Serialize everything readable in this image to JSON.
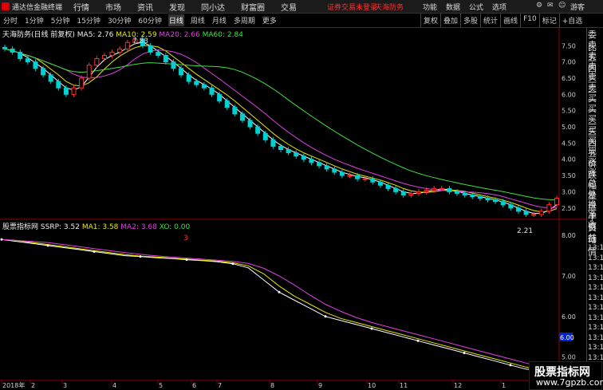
{
  "app": {
    "title": "通达信金融终端"
  },
  "menu": [
    "行情",
    "市场",
    "资讯",
    "发现",
    "同小达",
    "财富圈",
    "交易"
  ],
  "warning": "证券交易未登录",
  "stock_link": "天海防务",
  "right_menu": [
    "功能",
    "数据",
    "公式",
    "选项"
  ],
  "guest_label": "游客",
  "periods": [
    "分时",
    "1分钟",
    "5分钟",
    "15分钟",
    "30分钟",
    "60分钟",
    "日线",
    "周线",
    "月线",
    "多周期",
    "更多"
  ],
  "active_period": "日线",
  "tools": [
    "复权",
    "叠加",
    "多股",
    "统计",
    "画线",
    "F10",
    "标记",
    "+自选"
  ],
  "main_legend": {
    "name": "天海防务(日线 前复权)",
    "ma5": "MA5: 2.76",
    "ma10": "MA10: 2.59",
    "ma20": "MA20: 2.66",
    "ma60": "MA60: 2.84"
  },
  "sub_legend": {
    "name": "股票指标网",
    "ssrp": "SSRP: 3.52",
    "ma1": "MA1: 3.58",
    "ma2": "MA2: 3.68",
    "xo": "XO: 0.00"
  },
  "annotations": {
    "high": "7.83",
    "low": "2.21",
    "marker": "3",
    "current_label": "6.00"
  },
  "price_ticks": [
    "7.50",
    "7.00",
    "6.50",
    "6.00",
    "5.50",
    "5.00",
    "4.50",
    "4.00",
    "3.50",
    "3.00",
    "2.50"
  ],
  "sub_ticks": [
    "8.00",
    "7.00",
    "6.00",
    "5.00"
  ],
  "date_ticks": [
    "2018年",
    "2",
    "3",
    "4",
    "5",
    "6",
    "7",
    "8",
    "9",
    "10",
    "11",
    "12",
    "1"
  ],
  "right_panel": [
    "委比",
    "卖五",
    "卖四",
    "卖三",
    "卖二",
    "卖一",
    "买一",
    "买二",
    "买三",
    "买四",
    "买五",
    "现价",
    "涨跌",
    "涨幅",
    "总量",
    "外盘",
    "换手",
    "净资",
    "收益"
  ],
  "right_panel2": [
    "自动",
    "行情",
    "13:1",
    "13:1",
    "13:1",
    "13:1",
    "13:1",
    "13:1",
    "13:1",
    "13:1",
    "13:1",
    "13:1",
    "13:1",
    "13:1"
  ],
  "watermark": {
    "title": "股票指标网",
    "url": "www.7gpzb.com"
  },
  "colors": {
    "up": "#ff3030",
    "down": "#00d0d0",
    "ma5": "#ffffff",
    "ma10": "#e8e800",
    "ma20": "#e040e0",
    "ma60": "#40e040"
  },
  "chart_data": {
    "type": "candlestick",
    "price_range": [
      2.2,
      7.9
    ],
    "closes": [
      7.4,
      7.3,
      7.1,
      7.0,
      6.8,
      6.6,
      6.4,
      6.2,
      6.0,
      6.2,
      6.5,
      6.9,
      7.1,
      7.2,
      7.3,
      7.4,
      7.6,
      7.7,
      7.5,
      7.3,
      7.2,
      7.0,
      6.8,
      6.6,
      6.4,
      6.3,
      6.2,
      6.0,
      5.8,
      5.6,
      5.4,
      5.2,
      5.0,
      4.8,
      4.6,
      4.4,
      4.3,
      4.2,
      4.1,
      4.0,
      3.9,
      3.8,
      3.7,
      3.6,
      3.5,
      3.5,
      3.4,
      3.4,
      3.3,
      3.2,
      3.1,
      3.0,
      2.9,
      2.95,
      3.0,
      3.05,
      3.1,
      3.1,
      3.0,
      2.95,
      2.9,
      2.85,
      2.8,
      2.75,
      2.7,
      2.6,
      2.5,
      2.4,
      2.3,
      2.3,
      2.4,
      2.6,
      2.8
    ],
    "sub_values": [
      7.9,
      7.85,
      7.8,
      7.75,
      7.7,
      7.65,
      7.6,
      7.55,
      7.5,
      7.48,
      7.45,
      7.43,
      7.4,
      7.38,
      7.35,
      7.3,
      7.2,
      6.9,
      6.6,
      6.4,
      6.2,
      6.0,
      5.9,
      5.8,
      5.7,
      5.6,
      5.5,
      5.4,
      5.3,
      5.2,
      5.1,
      5.0,
      4.9,
      4.8,
      4.7,
      4.65,
      4.6
    ]
  }
}
